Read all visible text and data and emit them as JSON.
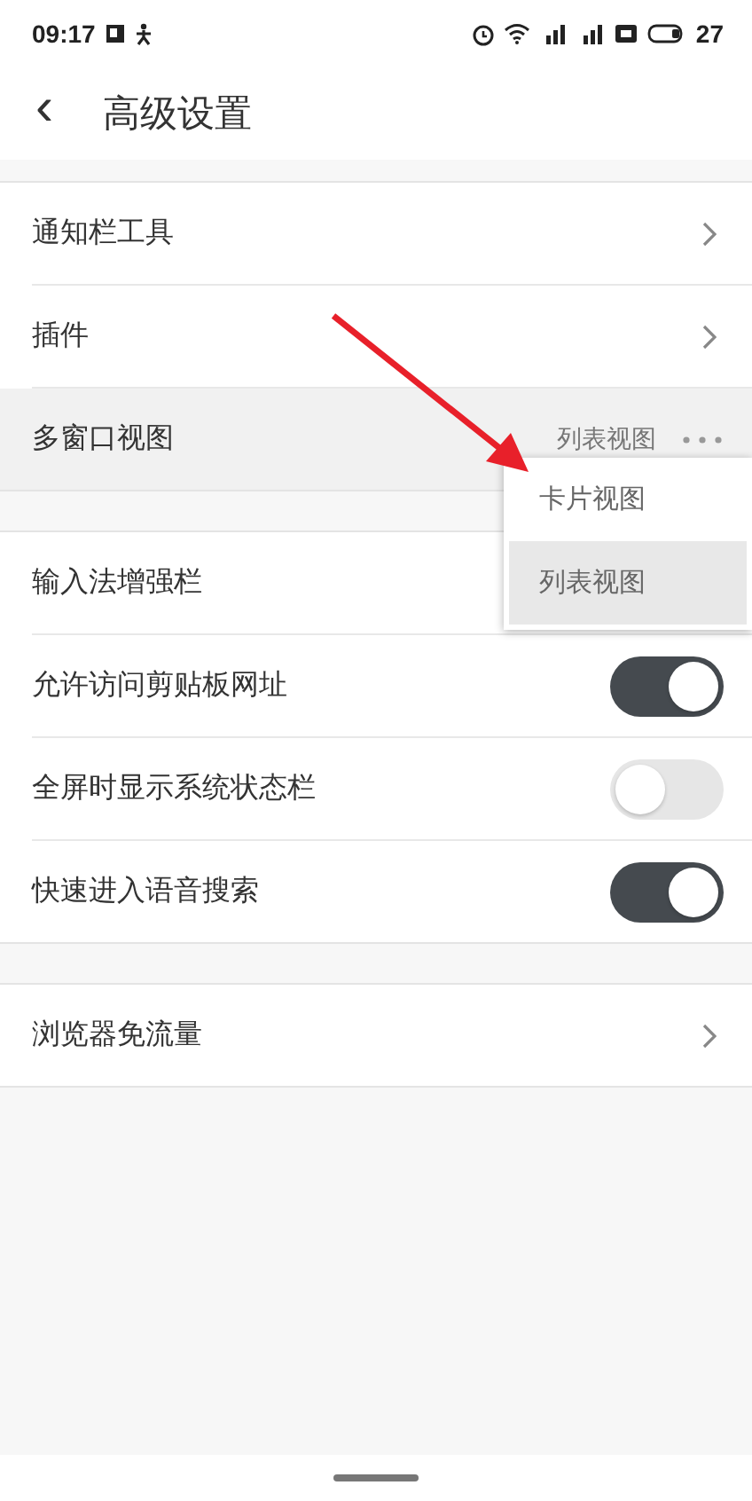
{
  "status_bar": {
    "time": "09:17",
    "battery": "27"
  },
  "header": {
    "back": "‹",
    "title": "高级设置"
  },
  "groups": [
    {
      "rows": [
        {
          "kind": "arrow",
          "label": "通知栏工具",
          "selected": false
        },
        {
          "kind": "arrow",
          "label": "插件",
          "selected": false
        },
        {
          "kind": "menu",
          "label": "多窗口视图",
          "value": "列表视图",
          "selected": true
        }
      ]
    },
    {
      "rows": [
        {
          "kind": "plain",
          "label": "输入法增强栏",
          "selected": false
        },
        {
          "kind": "toggle",
          "label": "允许访问剪贴板网址",
          "on": true,
          "selected": false
        },
        {
          "kind": "toggle",
          "label": "全屏时显示系统状态栏",
          "on": false,
          "selected": false
        },
        {
          "kind": "toggle",
          "label": "快速进入语音搜索",
          "on": true,
          "selected": false
        }
      ]
    },
    {
      "rows": [
        {
          "kind": "arrow",
          "label": "浏览器免流量",
          "selected": false
        }
      ]
    }
  ],
  "popup_menu": {
    "items": [
      {
        "label": "卡片视图",
        "selected": false
      },
      {
        "label": "列表视图",
        "selected": true
      }
    ]
  }
}
